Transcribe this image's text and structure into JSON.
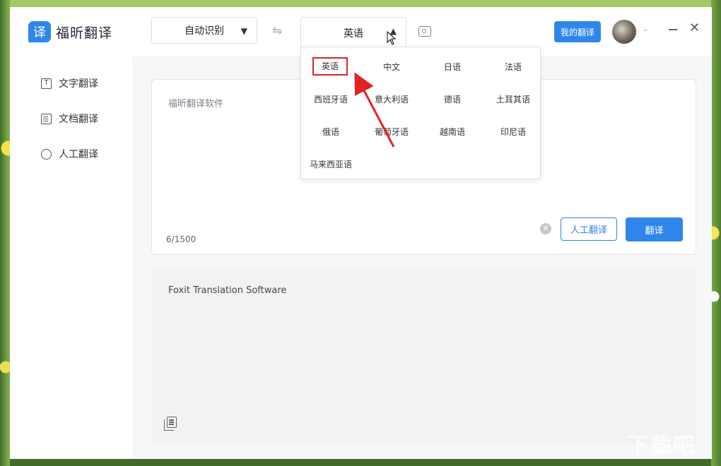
{
  "app": {
    "logo_glyph": "译",
    "name": "福昕翻译"
  },
  "header": {
    "source_lang": "自动识别",
    "target_lang": "英语",
    "swap_icon": "⇋",
    "my_translations": "我的翻译",
    "close_glyph": "✕"
  },
  "sidebar": {
    "items": [
      {
        "label": "文字翻译",
        "icon": "text-icon"
      },
      {
        "label": "文档翻译",
        "icon": "document-icon"
      },
      {
        "label": "人工翻译",
        "icon": "person-icon"
      }
    ]
  },
  "input": {
    "text": "福昕翻译软件",
    "char_count": "6/1500",
    "human_translate": "人工翻译",
    "translate": "翻译"
  },
  "output": {
    "text": "Foxit Translation Software"
  },
  "dropdown": {
    "selected": "英语",
    "options": [
      "英语",
      "中文",
      "日语",
      "法语",
      "西班牙语",
      "意大利语",
      "德语",
      "土耳其语",
      "俄语",
      "葡萄牙语",
      "越南语",
      "印尼语",
      "马来西亚语"
    ]
  },
  "colors": {
    "accent": "#2f86ea",
    "highlight": "#d6262b"
  }
}
